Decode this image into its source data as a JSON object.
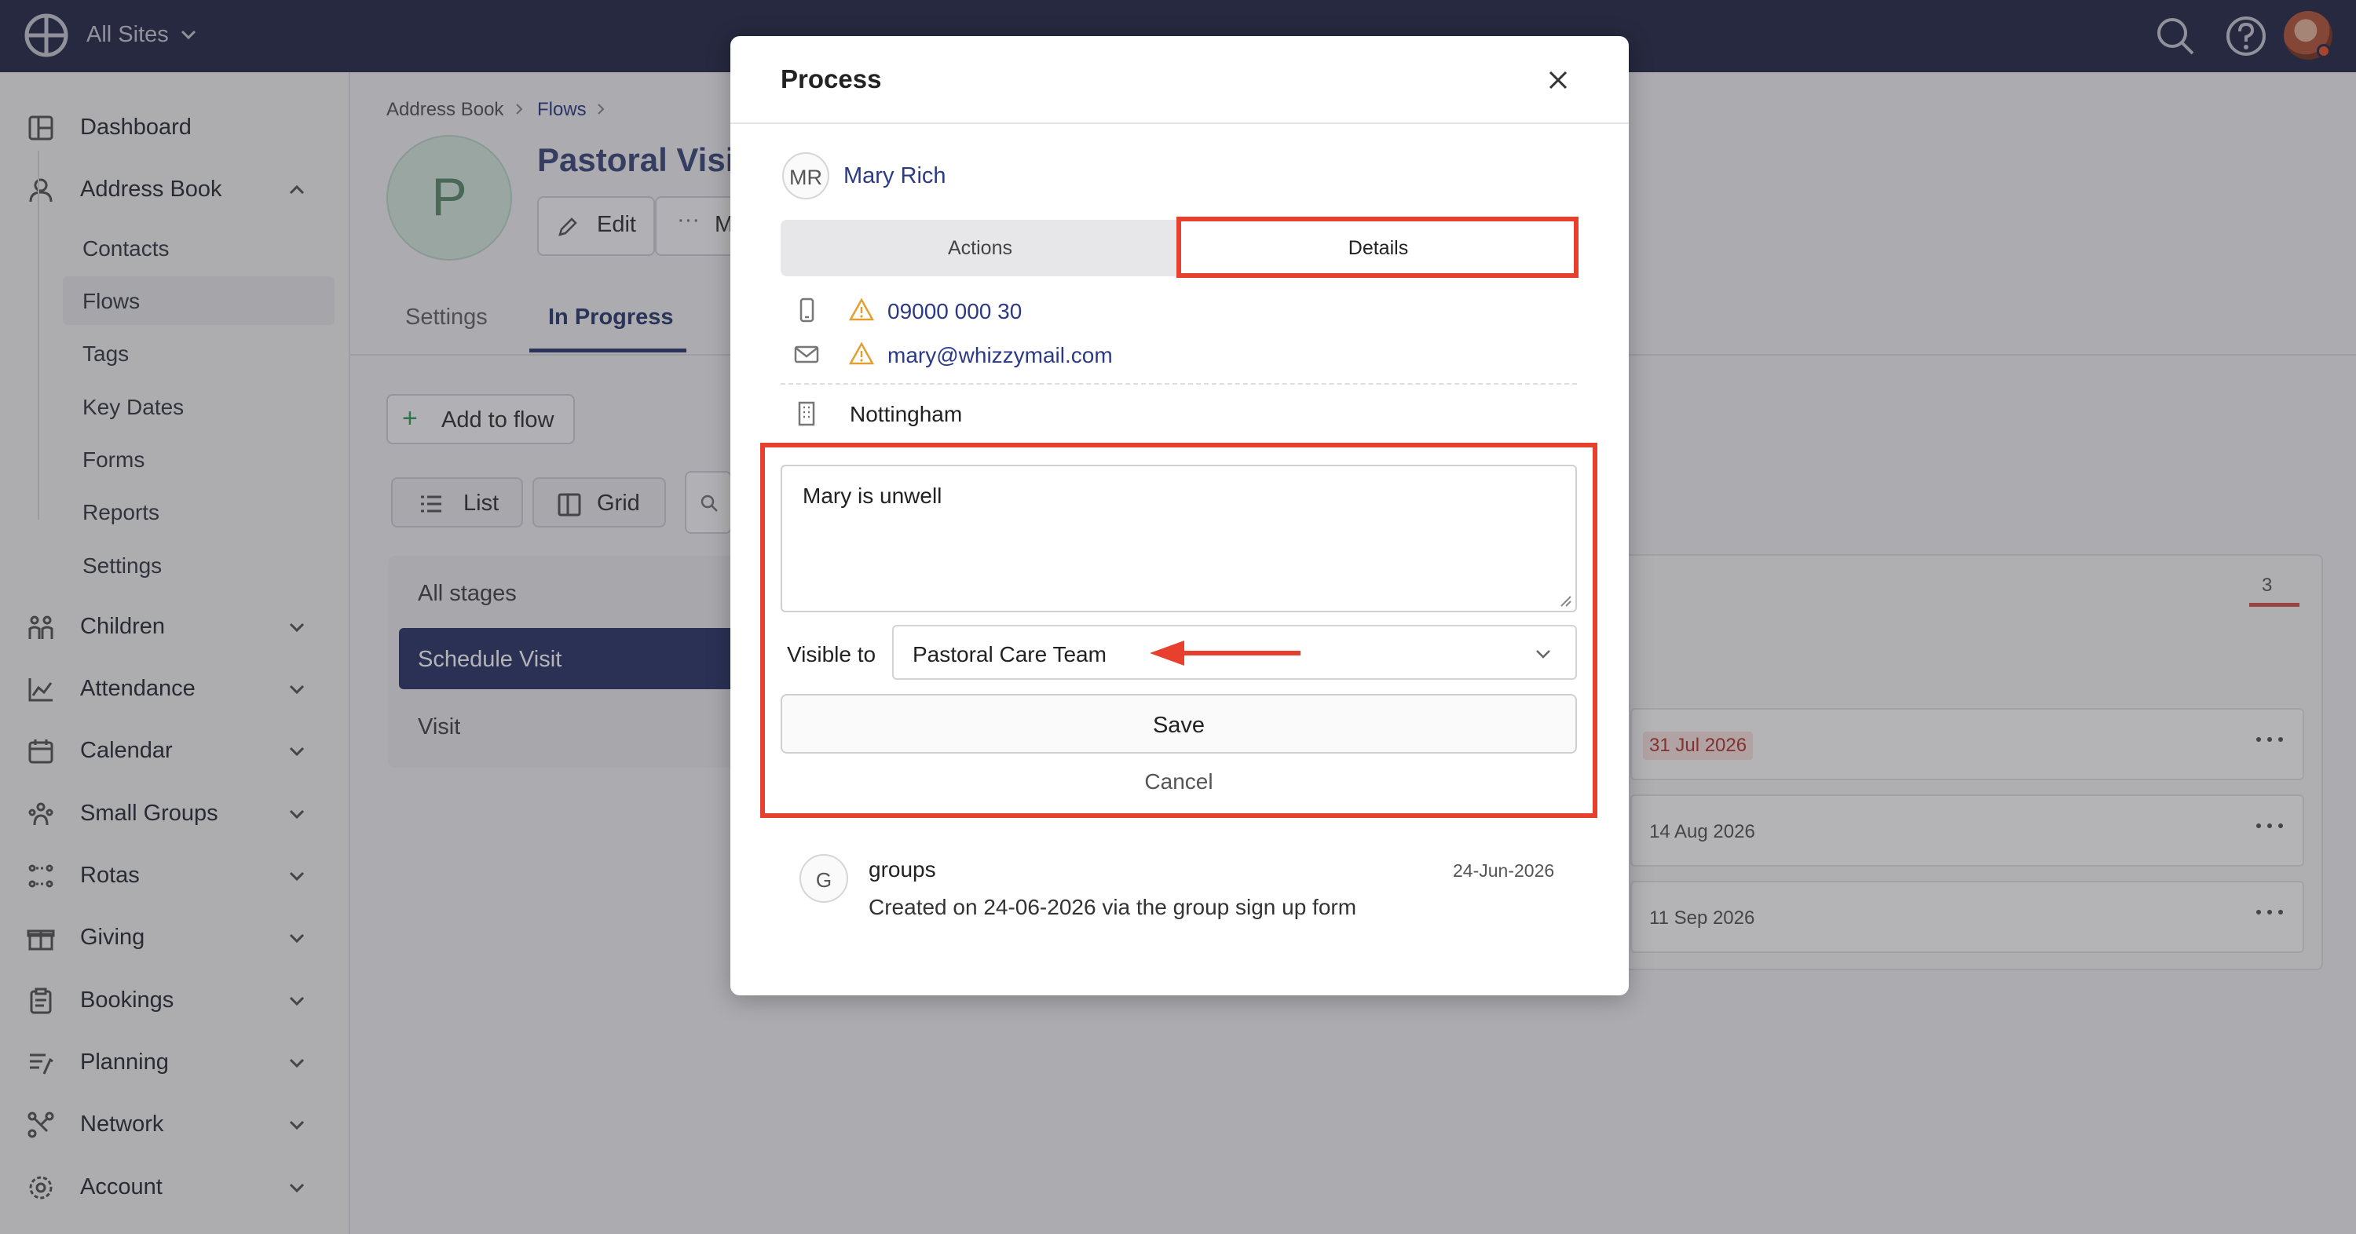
{
  "topbar": {
    "sites_label": "All Sites",
    "icons": [
      "globe-icon",
      "chevron-down-icon",
      "search-icon",
      "help-icon",
      "avatar"
    ]
  },
  "sidebar": {
    "items": [
      {
        "label": "Dashboard",
        "icon": "dashboard-icon"
      },
      {
        "label": "Address Book",
        "icon": "person-icon"
      },
      {
        "label": "Children",
        "icon": "children-icon"
      },
      {
        "label": "Attendance",
        "icon": "chart-icon"
      },
      {
        "label": "Calendar",
        "icon": "calendar-icon"
      },
      {
        "label": "Small Groups",
        "icon": "groups-icon"
      },
      {
        "label": "Rotas",
        "icon": "rotas-icon"
      },
      {
        "label": "Giving",
        "icon": "gift-icon"
      },
      {
        "label": "Bookings",
        "icon": "clipboard-icon"
      },
      {
        "label": "Planning",
        "icon": "planning-icon"
      },
      {
        "label": "Network",
        "icon": "network-icon"
      },
      {
        "label": "Account",
        "icon": "gear-icon"
      }
    ],
    "sub_items": [
      "Contacts",
      "Flows",
      "Tags",
      "Key Dates",
      "Forms",
      "Reports",
      "Settings"
    ]
  },
  "main": {
    "breadcrumb": [
      "Address Book",
      "Flows"
    ],
    "avatar_letter": "P",
    "title": "Pastoral Visit",
    "edit_label": "Edit",
    "more_label": "M",
    "tabs": [
      "Settings",
      "In Progress"
    ],
    "add_to_flow_label": "Add to flow",
    "view_list": "List",
    "view_grid": "Grid",
    "stages": [
      "All stages",
      "Schedule Visit",
      "Visit"
    ],
    "count": "3",
    "dates": [
      "31 Jul 2026",
      "14 Aug 2026",
      "11 Sep 2026"
    ]
  },
  "modal": {
    "title": "Process",
    "person_initials": "MR",
    "person_name": "Mary Rich",
    "segments": {
      "actions": "Actions",
      "details": "Details"
    },
    "phone": "09000 000 30",
    "email": "mary@whizzymail.com",
    "location": "Nottingham",
    "note_value": "Mary is unwell",
    "visible_to_label": "Visible to",
    "visible_to_value": "Pastoral Care Team",
    "save_label": "Save",
    "cancel_label": "Cancel",
    "activity": {
      "initial": "G",
      "user": "groups",
      "date": "24-Jun-2026",
      "text": "Created on 24-06-2026 via the group sign up form"
    }
  },
  "colors": {
    "topbar": "#262a48",
    "accent": "#2c3a86",
    "highlight": "#e8402f",
    "warning": "#e0a030"
  }
}
